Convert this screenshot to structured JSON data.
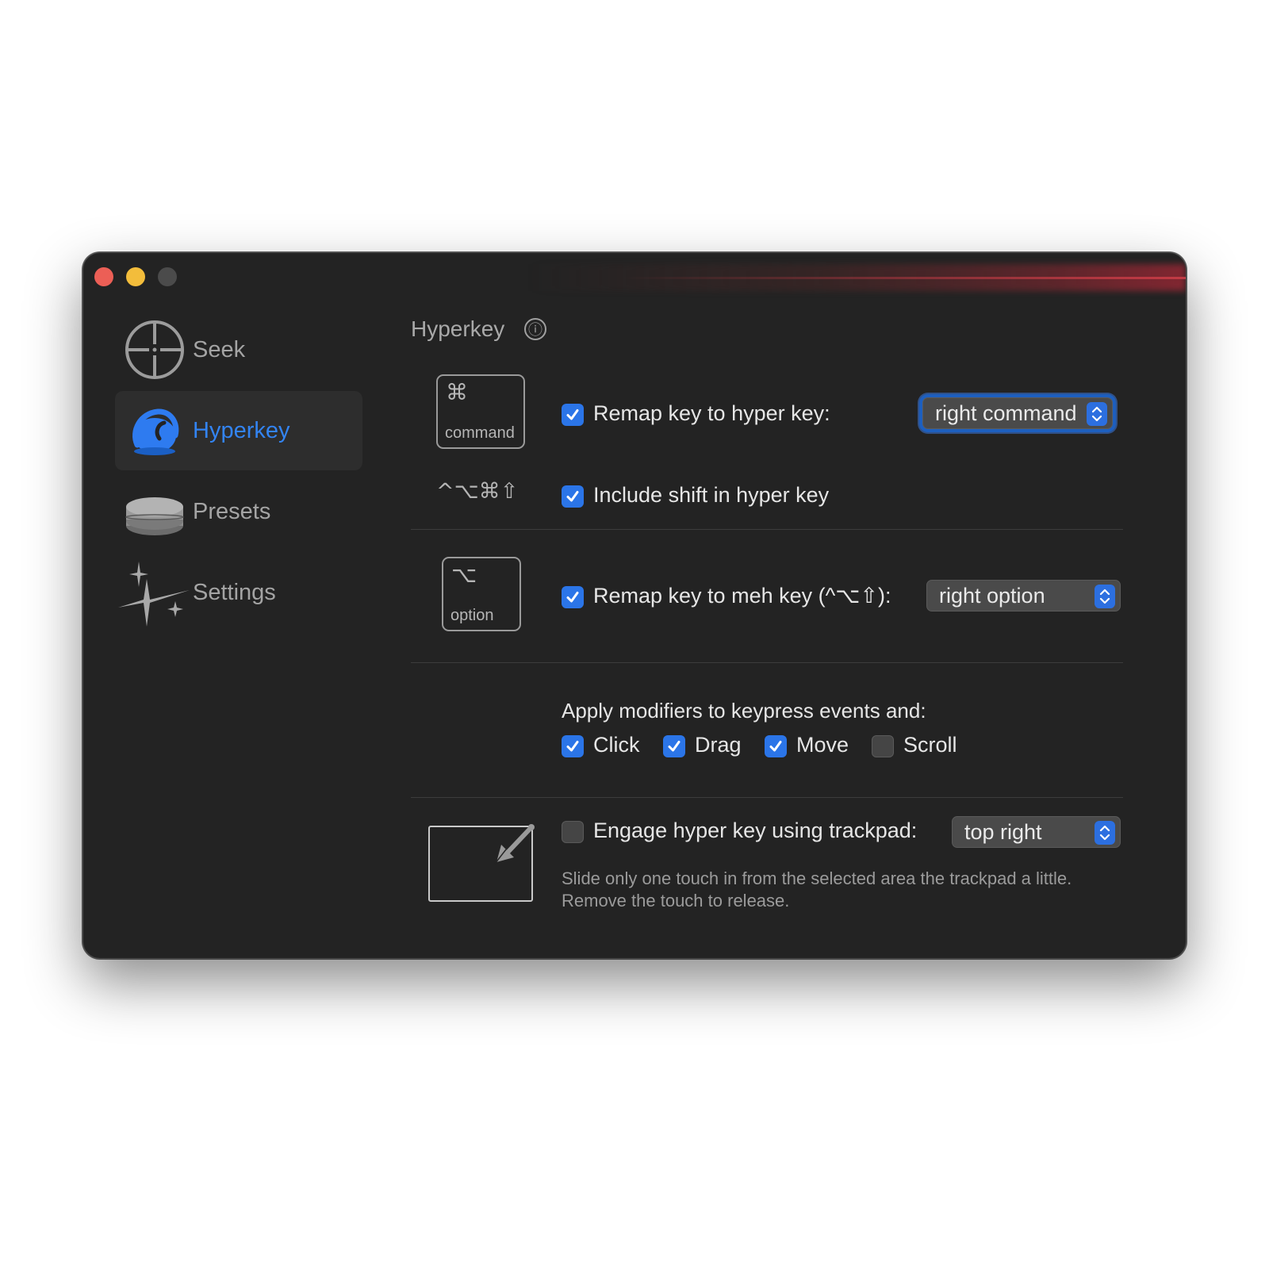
{
  "window": {
    "controls": {
      "close": "close",
      "minimize": "minimize",
      "zoom": "zoom"
    }
  },
  "sidebar": {
    "items": [
      {
        "label": "Seek",
        "icon": "crosshair-icon",
        "active": false
      },
      {
        "label": "Hyperkey",
        "icon": "hyperkey-icon",
        "active": true
      },
      {
        "label": "Presets",
        "icon": "presets-stack-icon",
        "active": false
      },
      {
        "label": "Settings",
        "icon": "sparkles-icon",
        "active": false
      }
    ]
  },
  "main": {
    "title": "Hyperkey",
    "info_icon": "ⓘ",
    "hyper": {
      "keycap_symbol": "⌘",
      "keycap_name": "command",
      "remap_label": "Remap key to hyper key:",
      "remap_checked": true,
      "remap_value": "right command",
      "modifier_glyphs": "^⌥⌘⇧",
      "shift_label": "Include shift in hyper key",
      "shift_checked": true
    },
    "meh": {
      "keycap_symbol": "⌥",
      "keycap_name": "option",
      "remap_label": "Remap key to meh key (^⌥⇧):",
      "remap_checked": true,
      "remap_value": "right option"
    },
    "modifiers": {
      "heading": "Apply modifiers to keypress events and:",
      "options": [
        {
          "label": "Click",
          "checked": true
        },
        {
          "label": "Drag",
          "checked": true
        },
        {
          "label": "Move",
          "checked": true
        },
        {
          "label": "Scroll",
          "checked": false
        }
      ]
    },
    "trackpad": {
      "label": "Engage hyper key using trackpad:",
      "checked": false,
      "value": "top right",
      "hint_line1": "Slide only one touch in from the selected area the trackpad a little.",
      "hint_line2": "Remove the touch to release."
    }
  },
  "colors": {
    "window_bg": "#232323",
    "accent": "#2b75e8",
    "active_label": "#3384f2",
    "close": "#ec5f56",
    "minimize": "#f3bd3b"
  }
}
